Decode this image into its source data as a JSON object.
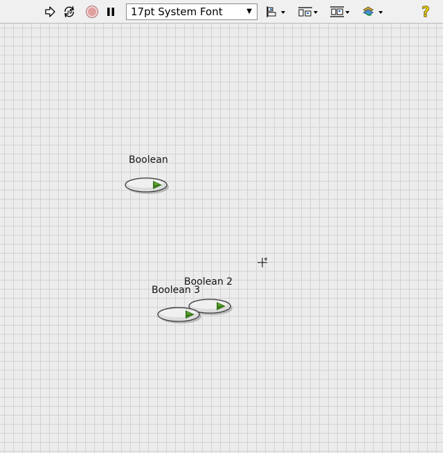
{
  "toolbar": {
    "font_select": {
      "value": "17pt System Font"
    },
    "icons": {
      "run": "run-arrow-icon",
      "run_continuously": "run-continuously-icon",
      "abort": "abort-stop-icon",
      "pause": "pause-icon",
      "align": "align-objects-icon",
      "distribute": "distribute-objects-icon",
      "resize": "resize-objects-icon",
      "reorder": "reorder-icon",
      "help": "context-help-icon"
    }
  },
  "front_panel": {
    "controls": [
      {
        "label": "Boolean"
      },
      {
        "label": "Boolean 2"
      },
      {
        "label": "Boolean 3"
      }
    ]
  },
  "colors": {
    "grid_bg": "#ececec",
    "grid_line": "#d2d2d2",
    "led_green": "#3a7a1a",
    "abort_red": "#e0a0a0",
    "help_yellow": "#f5d800"
  }
}
